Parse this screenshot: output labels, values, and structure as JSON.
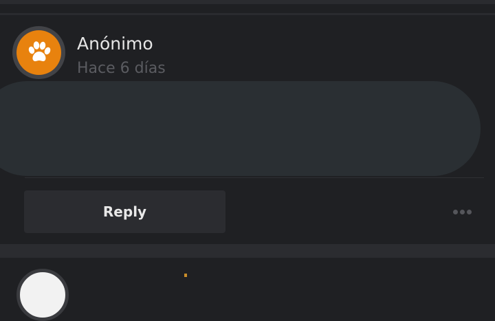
{
  "comment": {
    "author": "Anónimo",
    "timestamp": "Hace 6 días",
    "avatar_icon": "paw-icon",
    "avatar_color": "#e8820e",
    "reply_label": "Reply",
    "more_icon": "ellipsis-icon"
  }
}
